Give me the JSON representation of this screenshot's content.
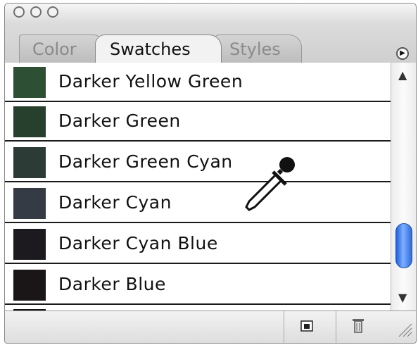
{
  "window": {
    "traffic_lights": [
      "close-icon",
      "minimize-icon",
      "zoom-icon"
    ]
  },
  "tabs": [
    {
      "label": "Color",
      "active": false
    },
    {
      "label": "Swatches",
      "active": true
    },
    {
      "label": "Styles",
      "active": false
    }
  ],
  "panel_menu_icon": "panel-menu-icon",
  "swatches": [
    {
      "label": "Darker Yellow Green",
      "color": "#2d4f33"
    },
    {
      "label": "Darker Green",
      "color": "#27402e"
    },
    {
      "label": "Darker Green Cyan",
      "color": "#2d3b37"
    },
    {
      "label": "Darker Cyan",
      "color": "#343b45"
    },
    {
      "label": "Darker Cyan Blue",
      "color": "#1c1a1f"
    },
    {
      "label": "Darker Blue",
      "color": "#1a1618"
    },
    {
      "label": "",
      "color": "#141214"
    }
  ],
  "footer": {
    "new_swatch_icon": "new-swatch-icon",
    "trash_icon": "trash-icon"
  },
  "cursor": "eyedropper-cursor-icon"
}
